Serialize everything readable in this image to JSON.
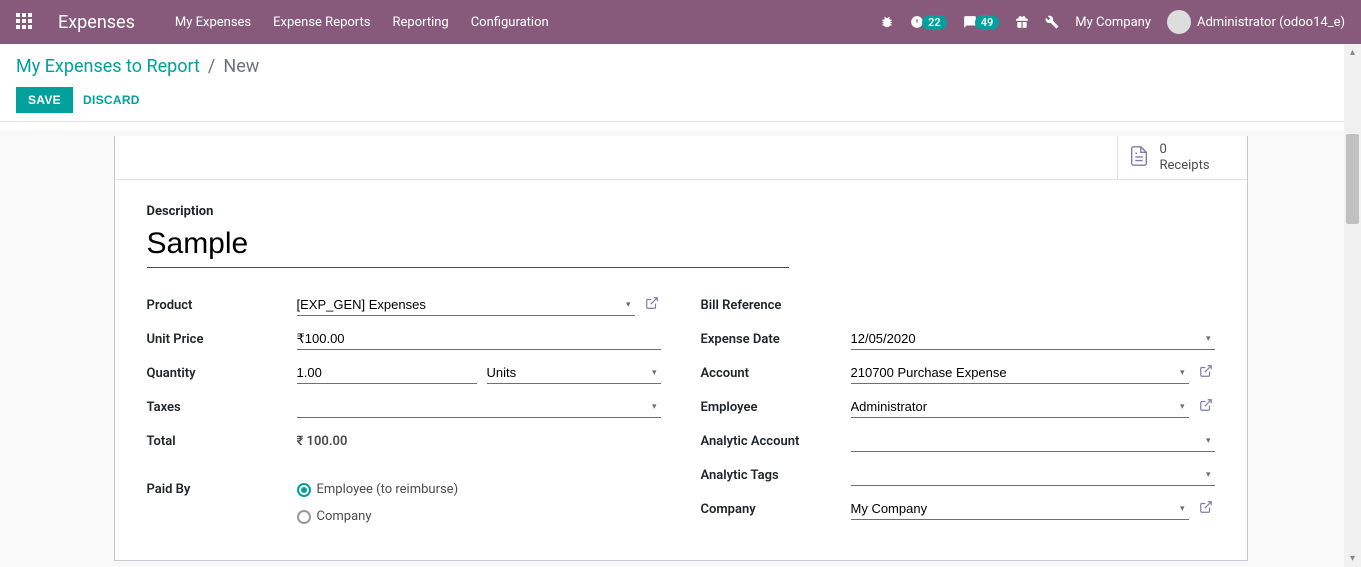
{
  "navbar": {
    "brand": "Expenses",
    "menu": [
      "My Expenses",
      "Expense Reports",
      "Reporting",
      "Configuration"
    ],
    "activities_badge": "22",
    "messages_badge": "49",
    "company": "My Company",
    "user": "Administrator (odoo14_e)"
  },
  "cp": {
    "breadcrumb_link": "My Expenses to Report",
    "breadcrumb_current": "New",
    "save": "SAVE",
    "discard": "DISCARD"
  },
  "stat": {
    "receipts_count": "0",
    "receipts_label": "Receipts"
  },
  "form": {
    "description_label": "Description",
    "description_value": "Sample",
    "labels": {
      "product": "Product",
      "unit_price": "Unit Price",
      "quantity": "Quantity",
      "taxes": "Taxes",
      "total": "Total",
      "bill_ref": "Bill Reference",
      "expense_date": "Expense Date",
      "account": "Account",
      "employee": "Employee",
      "analytic_account": "Analytic Account",
      "analytic_tags": "Analytic Tags",
      "company": "Company",
      "paid_by": "Paid By"
    },
    "values": {
      "product": "[EXP_GEN] Expenses",
      "unit_price": "₹100.00",
      "quantity": "1.00",
      "uom": "Units",
      "taxes": "",
      "total": "₹ 100.00",
      "bill_ref": "",
      "expense_date": "12/05/2020",
      "account": "210700 Purchase Expense",
      "employee": "Administrator",
      "analytic_account": "",
      "analytic_tags": "",
      "company": "My Company"
    },
    "paid_by_options": {
      "employee": "Employee (to reimburse)",
      "company": "Company"
    },
    "paid_by_selected": "employee"
  }
}
